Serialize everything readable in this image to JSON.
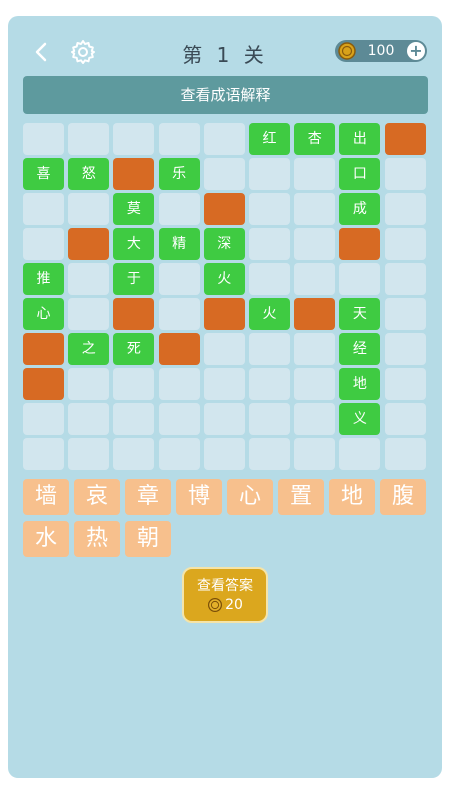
{
  "header": {
    "level_title": "第 1 关",
    "coins": "100",
    "back_icon": "chevron-left-icon",
    "settings_icon": "gear-icon",
    "coin_icon": "coin-icon",
    "plus_icon": "plus-icon"
  },
  "banner": {
    "label": "查看成语解释"
  },
  "colors": {
    "green": "#3fcb42",
    "orange": "#d76a23",
    "empty": "#d2e6ee",
    "tile": "#f7c08d",
    "button": "#dba71e"
  },
  "board": [
    [
      "",
      "",
      "",
      "",
      "",
      "G:红",
      "G:杏",
      "G:出",
      "O:"
    ],
    [
      "G:喜",
      "G:怒",
      "O:",
      "G:乐",
      "",
      "",
      "",
      "G:口",
      ""
    ],
    [
      "",
      "",
      "G:莫",
      "",
      "O:",
      "",
      "",
      "G:成",
      ""
    ],
    [
      "",
      "O:",
      "G:大",
      "G:精",
      "G:深",
      "",
      "",
      "O:",
      ""
    ],
    [
      "G:推",
      "",
      "G:于",
      "",
      "G:火",
      "",
      "",
      "",
      ""
    ],
    [
      "G:心",
      "",
      "O:",
      "",
      "O:",
      "G:火",
      "O:",
      "G:天",
      ""
    ],
    [
      "O:",
      "G:之",
      "G:死",
      "O:",
      "",
      "",
      "",
      "G:经",
      ""
    ],
    [
      "O:",
      "",
      "",
      "",
      "",
      "",
      "",
      "G:地",
      ""
    ],
    [
      "",
      "",
      "",
      "",
      "",
      "",
      "",
      "G:义",
      ""
    ],
    [
      "",
      "",
      "",
      "",
      "",
      "",
      "",
      "",
      ""
    ]
  ],
  "pool": [
    "墙",
    "哀",
    "章",
    "博",
    "心",
    "置",
    "地",
    "腹",
    "水",
    "热",
    "朝"
  ],
  "answer_button": {
    "label": "查看答案",
    "cost": "20"
  }
}
